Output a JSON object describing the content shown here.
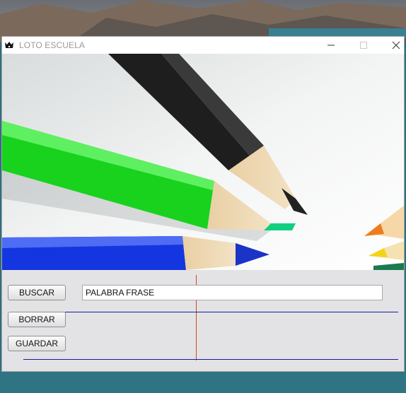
{
  "window": {
    "title": "LOTO ESCUELA"
  },
  "icons": {
    "app": "app-logo-icon",
    "minimize": "minimize-icon",
    "maximize": "maximize-icon",
    "close": "close-icon"
  },
  "buttons": {
    "buscar": "BUSCAR",
    "borrar": "BORRAR",
    "guardar": "GUARDAR"
  },
  "search": {
    "value": "PALABRA FRASE"
  },
  "colors": {
    "vertical_line": "#cc4a1a",
    "horizontal_line": "#1a1a9c"
  }
}
